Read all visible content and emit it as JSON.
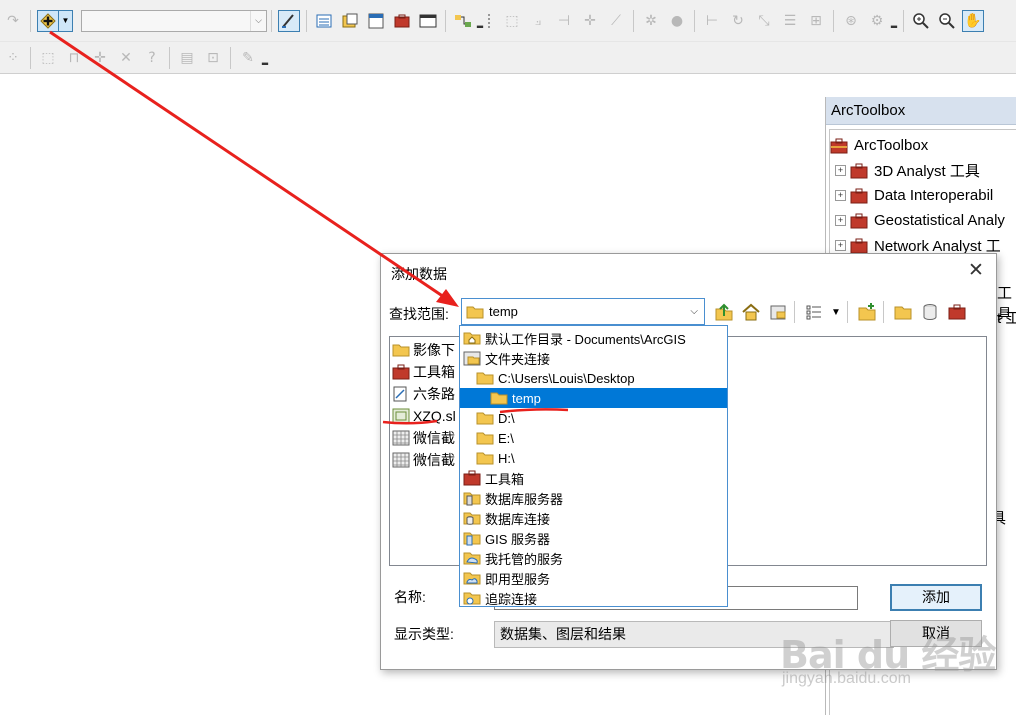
{
  "toolbar": {
    "combo_value": ""
  },
  "arctoolbox": {
    "title": "ArcToolbox",
    "root_label": "ArcToolbox",
    "items": [
      {
        "label": "3D Analyst 工具"
      },
      {
        "label": "Data Interoperabil"
      },
      {
        "label": "Geostatistical Analy"
      },
      {
        "label": "Network Analyst 工"
      }
    ],
    "peek_1": "工具",
    "peek_2": "t 工",
    "peek_3": "具"
  },
  "dialog": {
    "title": "添加数据",
    "close_glyph": "✕",
    "lookin_label": "查找范围:",
    "lookin_value": "temp",
    "files": [
      {
        "label": "影像下"
      },
      {
        "label": "工具箱"
      },
      {
        "label": "六条路"
      },
      {
        "label": "XZQ.sl"
      },
      {
        "label": "微信截"
      },
      {
        "label": "微信截"
      }
    ],
    "name_label": "名称:",
    "name_value": "",
    "add_button": "添加",
    "type_label": "显示类型:",
    "type_value": "数据集、图层和结果",
    "cancel_button": "取消"
  },
  "dropdown": {
    "items": [
      {
        "label": "默认工作目录 - Documents\\ArcGIS"
      },
      {
        "label": "文件夹连接"
      },
      {
        "label": "C:\\Users\\Louis\\Desktop"
      },
      {
        "label": "temp"
      },
      {
        "label": "D:\\"
      },
      {
        "label": "E:\\"
      },
      {
        "label": "H:\\"
      },
      {
        "label": "工具箱"
      },
      {
        "label": "数据库服务器"
      },
      {
        "label": "数据库连接"
      },
      {
        "label": "GIS 服务器"
      },
      {
        "label": "我托管的服务"
      },
      {
        "label": "即用型服务"
      },
      {
        "label": "追踪连接"
      }
    ]
  },
  "watermark": {
    "logo": "Bai du 经验",
    "url": "jingyan.baidu.com"
  },
  "colors": {
    "selection": "#0078d7",
    "annotation": "#e8211d",
    "folder": "#f3c64f"
  }
}
